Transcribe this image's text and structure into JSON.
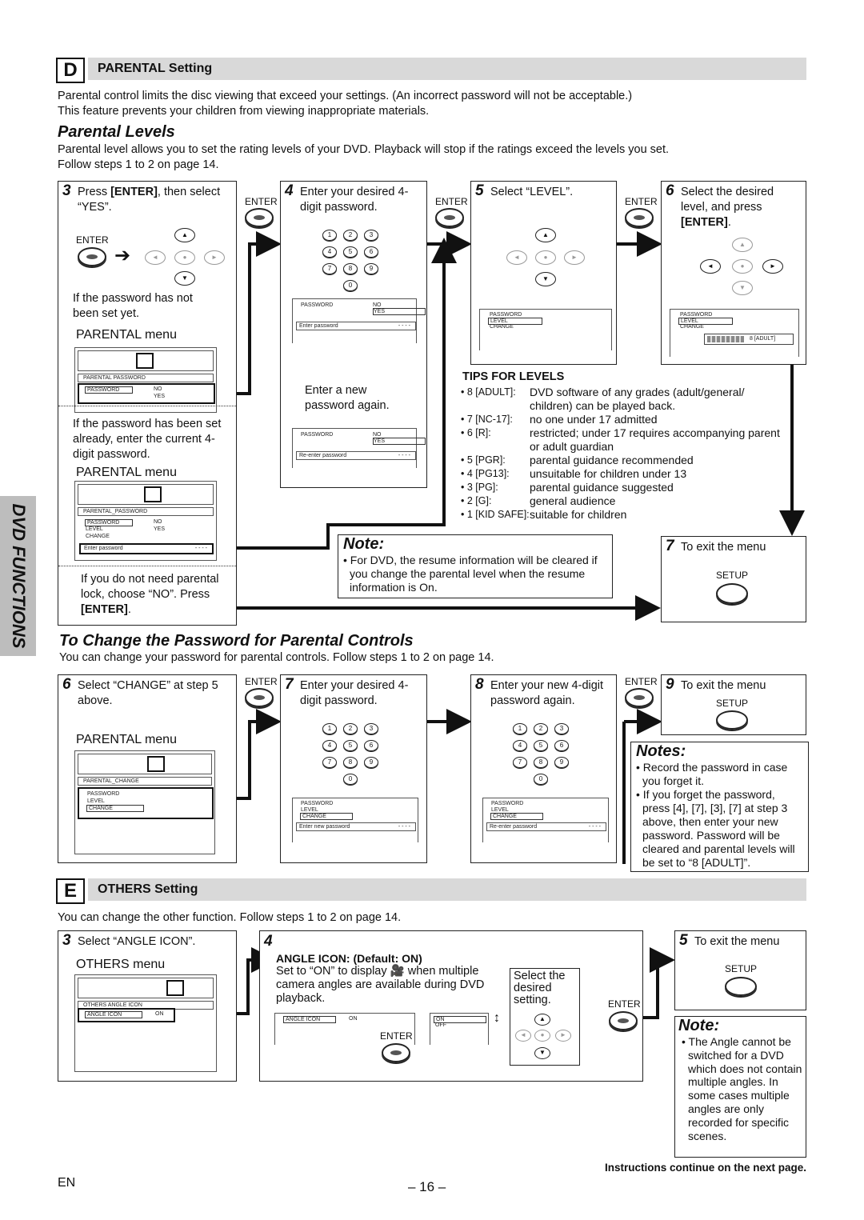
{
  "sectionD": {
    "letter": "D",
    "title": "PARENTAL Setting",
    "intro": [
      "Parental control limits the disc viewing that exceed your settings. (An incorrect password will not be acceptable.)",
      "This feature prevents your children from viewing inappropriate materials."
    ]
  },
  "parental_levels": {
    "title": "Parental Levels",
    "intro": [
      "Parental level allows you to set the rating levels of your DVD. Playback will stop if the ratings exceed the levels you set.",
      "Follow steps 1 to 2 on page 14."
    ]
  },
  "enter": "ENTER",
  "setup": "SETUP",
  "keypad": [
    "1",
    "2",
    "3",
    "4",
    "5",
    "6",
    "7",
    "8",
    "9",
    "0"
  ],
  "step3": {
    "num": "3",
    "text_a": "Press ",
    "text_b": "[ENTER]",
    "text_c": ", then select “YES”.",
    "not_set": "If the password has not been set yet.",
    "menu_label": "PARENTAL menu",
    "menu_title": "PARENTAL  PASSWORD",
    "password": "PASSWORD",
    "no": "NO",
    "yes": "YES",
    "been_set": "If the password has been set already, enter the current 4-digit password.",
    "menu_label2": "PARENTAL menu",
    "menu_title2": "PARENTAL_PASSWORD",
    "level": "LEVEL",
    "change": "CHANGE",
    "enter_password": "Enter password",
    "dashes": "- - - -",
    "no_need_a": "If you do not need parental lock, choose “NO”. Press ",
    "no_need_b": "[ENTER]",
    "no_need_c": "."
  },
  "step4": {
    "num": "4",
    "text": "Enter your desired 4-digit password.",
    "again": "Enter a new password again.",
    "reenter": "Re-enter password"
  },
  "step5": {
    "num": "5",
    "text": "Select “LEVEL”."
  },
  "step6": {
    "num": "6",
    "text": "Select the desired level, and press ",
    "bold": "[ENTER]",
    "end": ".",
    "level_value": "8 [ADULT]"
  },
  "tips": {
    "title": "TIPS FOR LEVELS",
    "items": [
      {
        "k": "• 8 [ADULT]:",
        "v": "DVD software of any grades (adult/general/ children) can be played back."
      },
      {
        "k": "• 7 [NC-17]:",
        "v": "no one under 17 admitted"
      },
      {
        "k": "• 6 [R]:",
        "v": "restricted; under 17 requires accompanying parent or adult guardian"
      },
      {
        "k": "• 5 [PGR]:",
        "v": "parental guidance recommended"
      },
      {
        "k": "• 4 [PG13]:",
        "v": "unsuitable for children under 13"
      },
      {
        "k": "• 3 [PG]:",
        "v": "parental guidance suggested"
      },
      {
        "k": "• 2 [G]:",
        "v": "general audience"
      },
      {
        "k": "• 1 [KID SAFE]:",
        "v": "suitable for children"
      }
    ]
  },
  "note1": {
    "title": "Note:",
    "text": "• For DVD, the resume information will be cleared if you change the parental level when the resume information is On."
  },
  "step7": {
    "num": "7",
    "text": "To exit the menu"
  },
  "change_pw": {
    "title": "To Change the Password for Parental Controls",
    "intro": "You can change your password for parental controls. Follow steps 1 to 2 on page 14."
  },
  "c6": {
    "num": "6",
    "text": "Select “CHANGE” at step 5 above.",
    "menu_label": "PARENTAL menu",
    "menu_title": "PARENTAL_CHANGE"
  },
  "c7": {
    "num": "7",
    "text": "Enter your desired 4-digit password.",
    "enter_new": "Enter new password"
  },
  "c8": {
    "num": "8",
    "text": "Enter your new 4-digit password again."
  },
  "c9": {
    "num": "9",
    "text": "To exit the menu"
  },
  "notes": {
    "title": "Notes:",
    "n1": "• Record the password in case you forget it.",
    "n2": "• If you forget the password, press [4], [7], [3], [7] at step 3 above, then enter your new password. Password will be cleared and parental levels will be set to “8 [ADULT]”."
  },
  "sectionE": {
    "letter": "E",
    "title": "OTHERS Setting",
    "intro": "You can change the other function. Follow steps 1 to 2 on page 14."
  },
  "e3": {
    "num": "3",
    "text": "Select “ANGLE ICON”.",
    "menu_label": "OTHERS menu",
    "menu_title": "OTHERS  ANGLE ICON",
    "angle_icon": "ANGLE ICON",
    "on": "ON",
    "off": "OFF"
  },
  "e4": {
    "num": "4",
    "heading_a": "ANGLE ICON: ",
    "heading_b": "(Default: ON)",
    "text_a": "Set to “ON” to display ",
    "text_b": " when multiple camera angles are available during DVD playback.",
    "select": "Select the desired setting."
  },
  "e5": {
    "num": "5",
    "text": "To exit the menu"
  },
  "note2": {
    "title": "Note:",
    "text": "• The Angle cannot be switched for a DVD which does not contain multiple angles. In some cases multiple angles are only recorded for specific scenes."
  },
  "side_tab": "DVD FUNCTIONS",
  "footer": {
    "continue": "Instructions continue on the next page.",
    "lang": "EN",
    "page": "– 16 –"
  }
}
